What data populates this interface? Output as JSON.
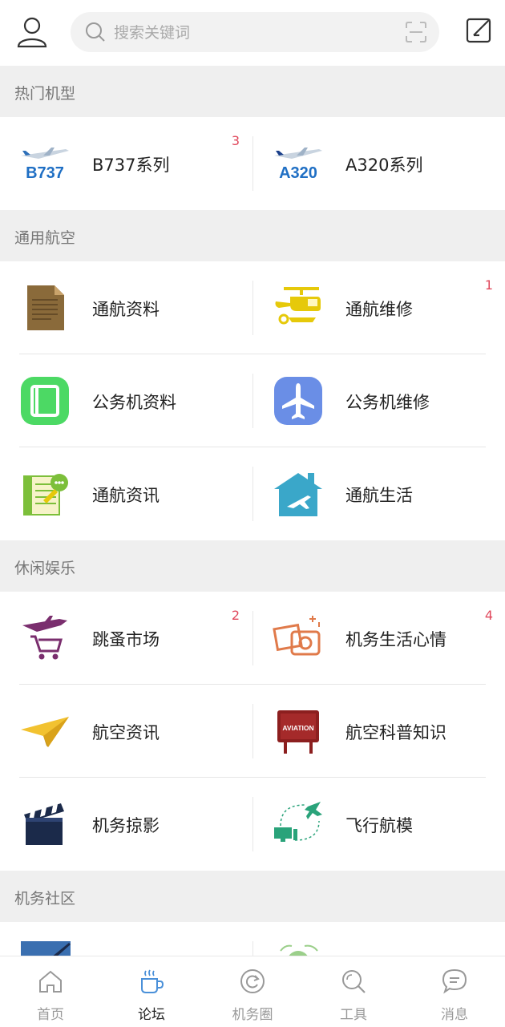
{
  "search": {
    "placeholder": "搜索关键词"
  },
  "sections": [
    {
      "title": "热门机型",
      "rows": [
        [
          {
            "label": "B737系列",
            "badge": "3",
            "icon": "b737-plane-icon",
            "icon_text": "B737"
          },
          {
            "label": "A320系列",
            "badge": "",
            "icon": "a320-plane-icon",
            "icon_text": "A320"
          }
        ]
      ]
    },
    {
      "title": "通用航空",
      "rows": [
        [
          {
            "label": "通航资料",
            "badge": "",
            "icon": "document-icon"
          },
          {
            "label": "通航维修",
            "badge": "1",
            "icon": "helicopter-wrench-icon"
          }
        ],
        [
          {
            "label": "公务机资料",
            "badge": "",
            "icon": "book-icon"
          },
          {
            "label": "公务机维修",
            "badge": "",
            "icon": "airplane-icon"
          }
        ],
        [
          {
            "label": "通航资讯",
            "badge": "",
            "icon": "news-icon"
          },
          {
            "label": "通航生活",
            "badge": "",
            "icon": "house-plane-icon"
          }
        ]
      ]
    },
    {
      "title": "休闲娱乐",
      "rows": [
        [
          {
            "label": "跳蚤市场",
            "badge": "2",
            "icon": "cart-plane-icon"
          },
          {
            "label": "机务生活心情",
            "badge": "4",
            "icon": "photo-camera-icon"
          }
        ],
        [
          {
            "label": "航空资讯",
            "badge": "",
            "icon": "paper-plane-icon"
          },
          {
            "label": "航空科普知识",
            "badge": "",
            "icon": "aviation-sign-icon",
            "icon_text": "AVIATION"
          }
        ],
        [
          {
            "label": "机务掠影",
            "badge": "",
            "icon": "clapperboard-icon"
          },
          {
            "label": "飞行航模",
            "badge": "",
            "icon": "computer-plane-icon"
          }
        ]
      ]
    },
    {
      "title": "机务社区",
      "rows": []
    }
  ],
  "bottom_nav": [
    {
      "label": "首页",
      "icon": "home-icon",
      "active": false
    },
    {
      "label": "论坛",
      "icon": "coffee-cup-icon",
      "active": true
    },
    {
      "label": "机务圈",
      "icon": "refresh-circle-icon",
      "active": false
    },
    {
      "label": "工具",
      "icon": "search-tool-icon",
      "active": false
    },
    {
      "label": "消息",
      "icon": "chat-bubble-icon",
      "active": false
    }
  ],
  "colors": {
    "badge": "#e0475b",
    "section_bg": "#efefef",
    "active_nav": "#4a90d9"
  }
}
